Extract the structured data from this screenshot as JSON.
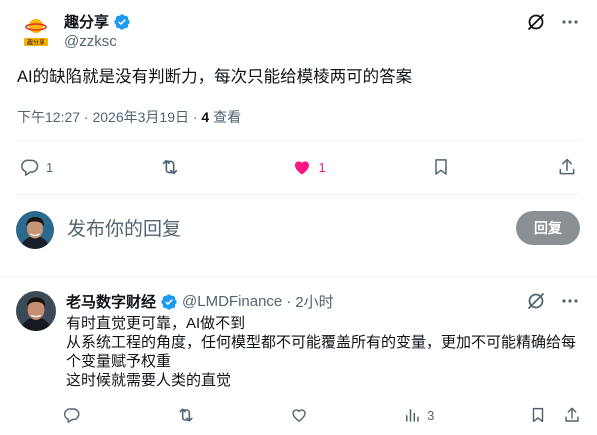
{
  "post": {
    "author_name": "趣分享",
    "author_handle": "@zzksc",
    "logo_text": "趣分享",
    "text": "AI的缺陷就是没有判断力，每次只能给模棱两可的答案",
    "timestamp": "下午12:27 · 2026年3月19日 · ",
    "views_count": "4",
    "views_label": " 查看",
    "actions": {
      "reply_count": "1",
      "retweet_count": "",
      "like_count": "1"
    }
  },
  "reply_composer": {
    "placeholder": "发布你的回复",
    "button_label": "回复"
  },
  "comment": {
    "author_name": "老马数字财经",
    "author_handle": "@LMDFinance",
    "separator": " · ",
    "time": "2小时",
    "lines": [
      "有时直觉更可靠，AI做不到",
      "从系统工程的角度，任何模型都不可能覆盖所有的变量，更加不可能精确给每个变量赋予权重",
      "这时候就需要人类的直觉"
    ],
    "views_count": "3"
  },
  "colors": {
    "verified": "#1d9bf0",
    "like": "#f91880",
    "muted": "#536471"
  }
}
